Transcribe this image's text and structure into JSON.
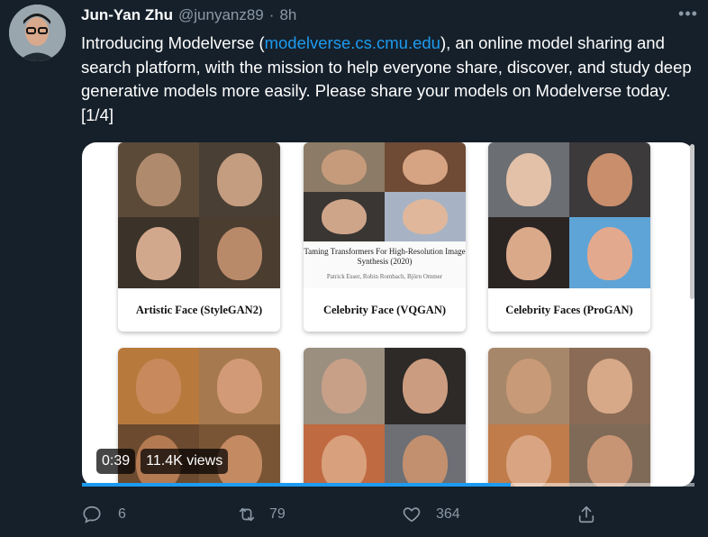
{
  "author": {
    "name": "Jun-Yan Zhu",
    "handle": "@junyanz89",
    "separator": "·",
    "time": "8h",
    "more_label": "•••"
  },
  "tweet": {
    "text_part1": "Introducing Modelverse (",
    "link": "modelverse.cs.cmu.edu",
    "text_part2": "), an online model sharing and search platform, with the mission to help everyone share, discover, and study deep generative models more easily. Please share your models on Modelverse today. [1/4]"
  },
  "media": {
    "cards": [
      {
        "label": "Artistic Face (StyleGAN2)"
      },
      {
        "label": "Celebrity Face (VQGAN)"
      },
      {
        "label": "Celebrity Faces (ProGAN)"
      }
    ],
    "paper": {
      "title": "Taming Transformers For High-Resolution Image Synthesis (2020)",
      "authors": "Patrick Esser, Robin Rombach, Björn Ommer"
    },
    "video": {
      "timestamp": "0:39",
      "views": "11.4K views",
      "progress": 0.7
    }
  },
  "actions": {
    "reply_count": "6",
    "retweet_count": "79",
    "like_count": "364"
  },
  "colors": {
    "background": "#15202b",
    "text_primary": "#ffffff",
    "text_secondary": "#8b98a5",
    "accent": "#1d9bf0"
  }
}
